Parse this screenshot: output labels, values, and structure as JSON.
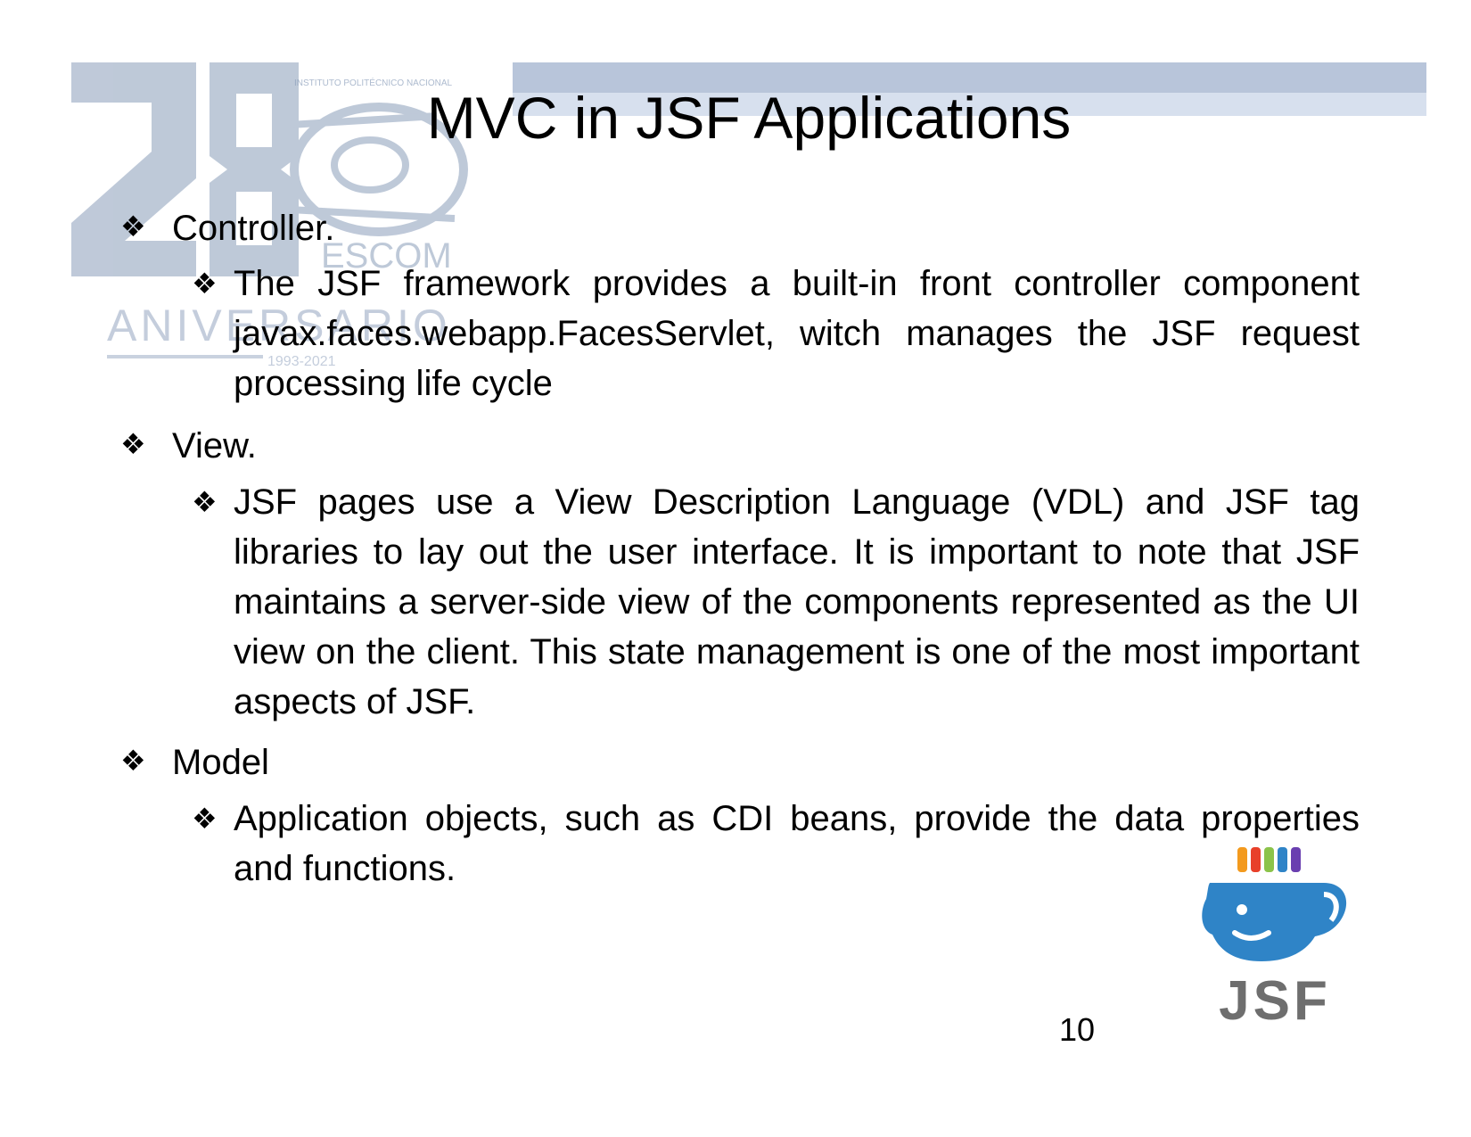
{
  "slide": {
    "title": "MVC in JSF Applications",
    "page_number": "10"
  },
  "watermark": {
    "institution": "INSTITUTO POLITÉCNICO NACIONAL",
    "number": "28",
    "school": "ESCOM",
    "word": "ANIVERSARIO",
    "years": "1993-2021"
  },
  "logo": {
    "text": "JSF",
    "colors": {
      "cup": "#2f84c7",
      "steam": [
        "#f39a1e",
        "#e8402a",
        "#8bc34a",
        "#2f84c7",
        "#6a3fb0"
      ],
      "text": "#6e6e6e"
    }
  },
  "bullets": [
    {
      "marker": "❖",
      "label": "Controller.",
      "items": [
        {
          "marker": "❖",
          "text": "The JSF framework provides a built-in front controller component javax.faces.webapp.FacesServlet, witch manages the JSF request processing life cycle"
        }
      ]
    },
    {
      "marker": "❖",
      "label": "View.",
      "items": [
        {
          "marker": "❖",
          "text": "JSF pages use a View Description Language (VDL) and JSF tag libraries to lay out the user interface. It is important to note that JSF maintains a server-side view of the components represented as the UI view on the client. This state management is one of the most important aspects of JSF."
        }
      ]
    },
    {
      "marker": "❖",
      "label": "Model",
      "items": [
        {
          "marker": "❖",
          "text": "Application objects, such as CDI beans, provide the data properties and functions."
        }
      ]
    }
  ]
}
